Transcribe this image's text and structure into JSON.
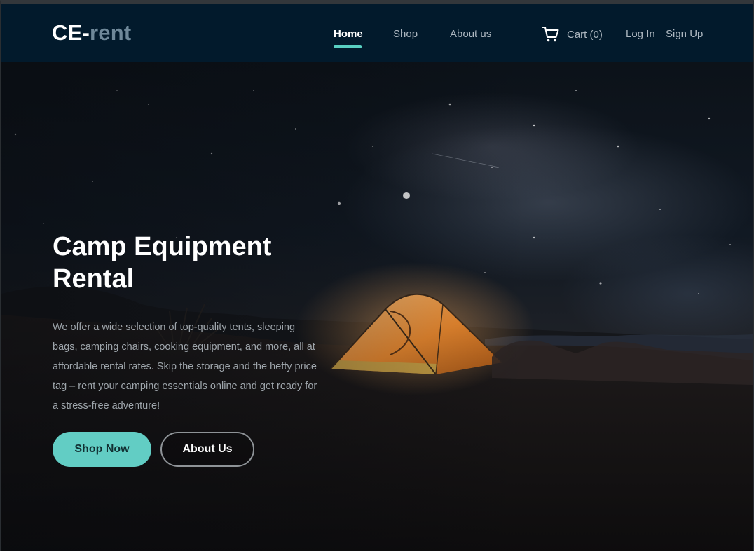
{
  "brand": {
    "prefix": "CE-",
    "suffix": "rent"
  },
  "nav": {
    "links": [
      {
        "label": "Home",
        "active": true
      },
      {
        "label": "Shop",
        "active": false
      },
      {
        "label": "About us",
        "active": false
      }
    ],
    "cart_label": "Cart (0)",
    "login_label": "Log In",
    "signup_label": "Sign Up",
    "cart_icon": "cart-icon"
  },
  "hero": {
    "title": "Camp Equipment Rental",
    "description": "We offer a wide selection of top-quality tents, sleeping bags, camping chairs, cooking equipment, and more, all at affordable rental rates. Skip the storage and the hefty price tag – rent your camping essentials online and get ready for a stress-free adventure!",
    "primary_button": "Shop Now",
    "secondary_button": "About Us"
  },
  "colors": {
    "navbar_bg": "#021a2c",
    "accent": "#62cdc4",
    "logo_suffix": "#6f8899"
  }
}
